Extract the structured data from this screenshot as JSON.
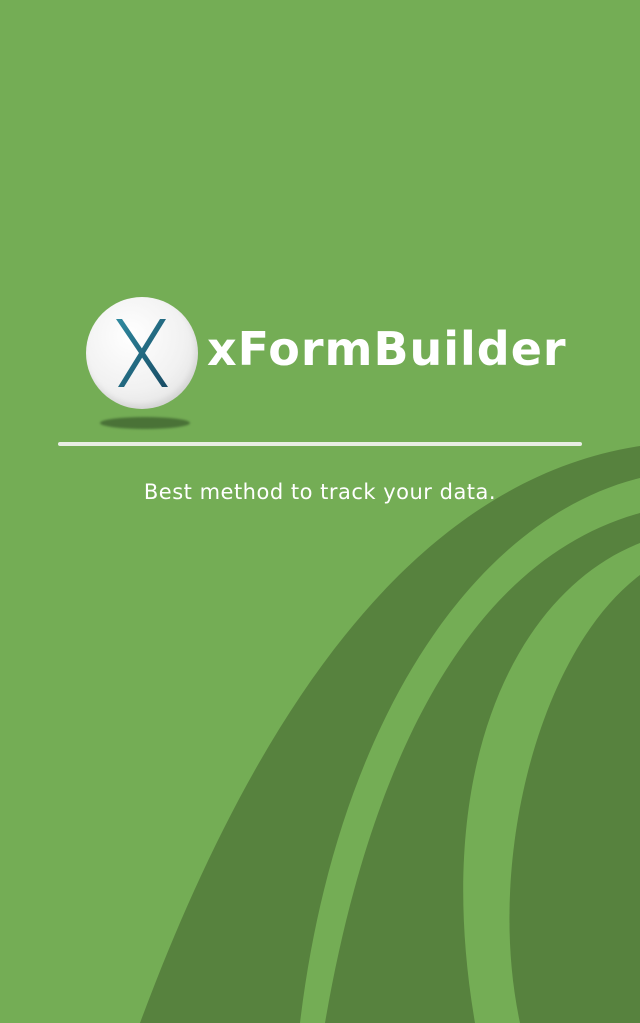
{
  "app": {
    "title": "xFormBuilder",
    "tagline": "Best method to track your data."
  },
  "logo": {
    "icon": "x-logo-icon"
  },
  "colors": {
    "background": "#74ad55",
    "swoosh": "#57823e",
    "text": "#ffffff",
    "divider": "#e8eee4",
    "logo_x_stroke": "#1e5f7a"
  }
}
